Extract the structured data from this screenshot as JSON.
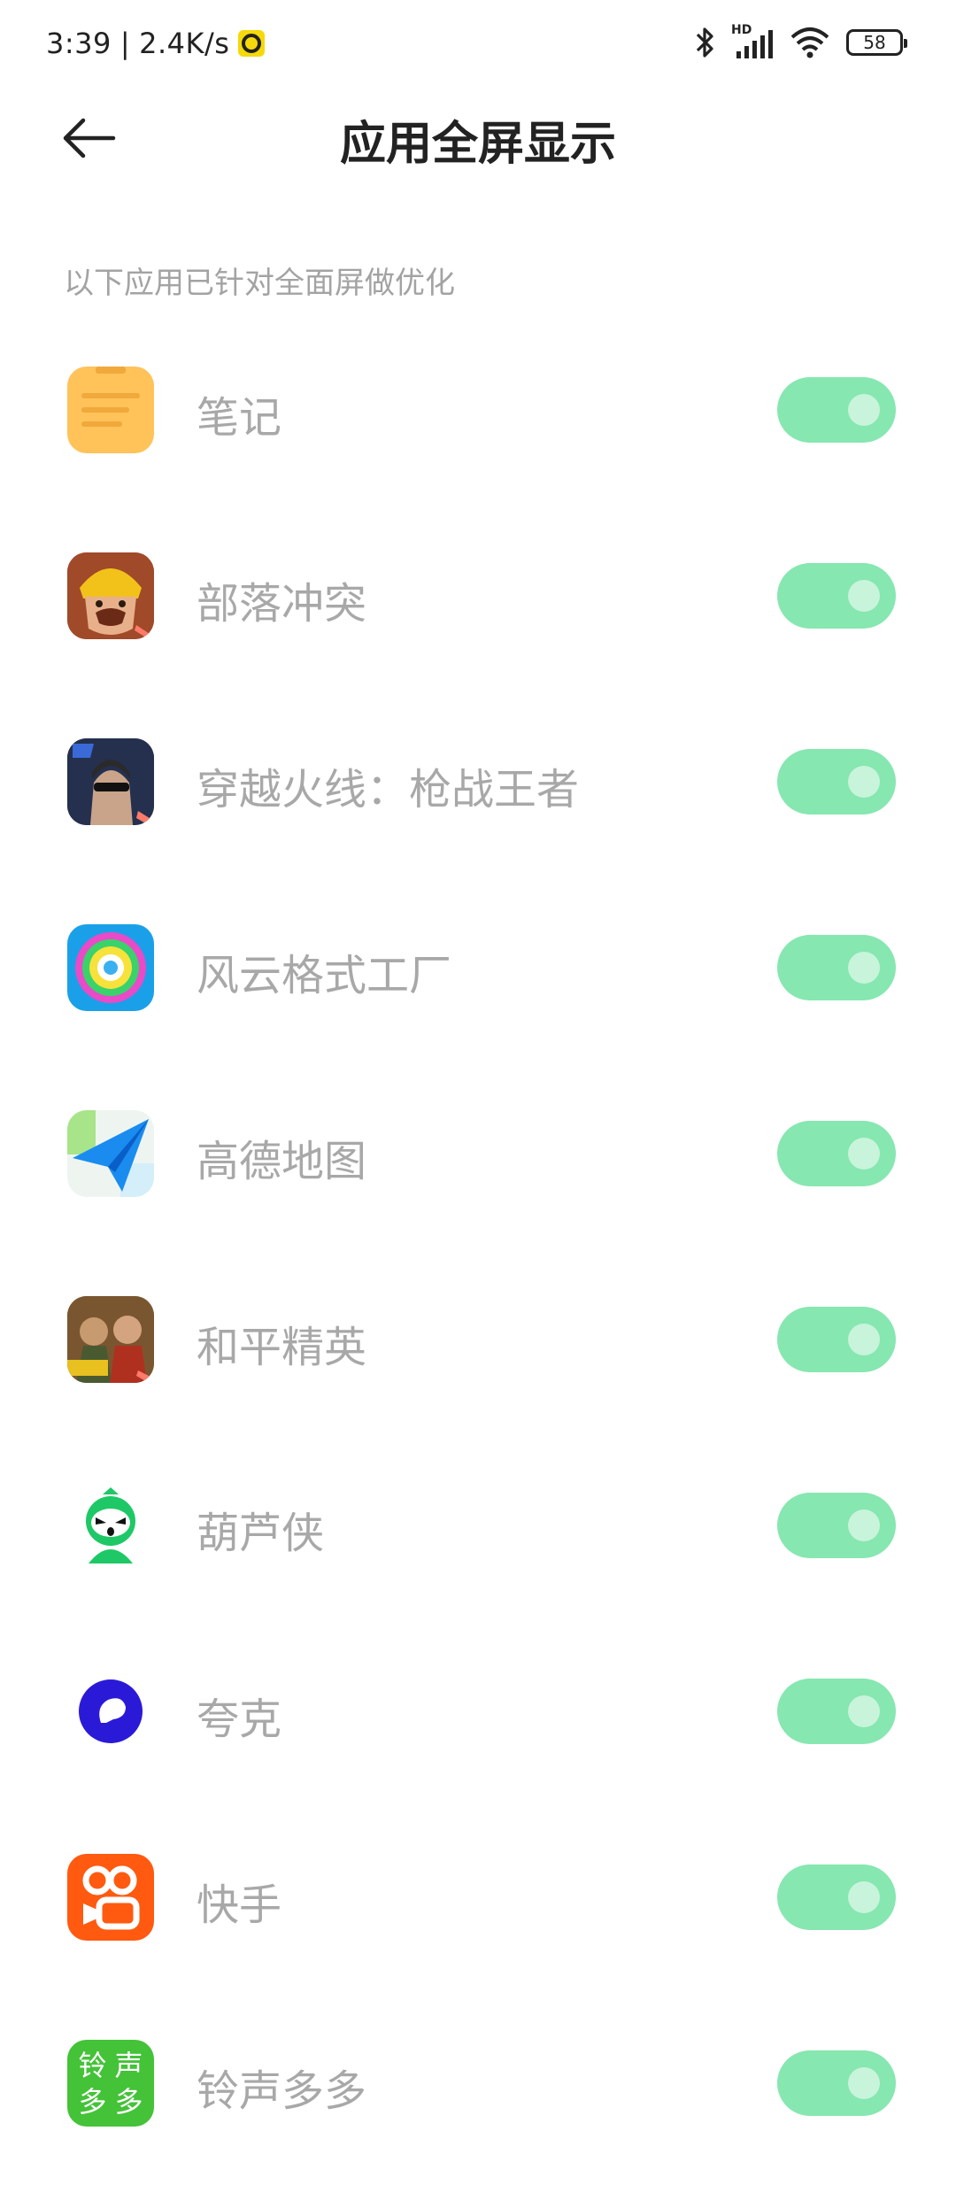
{
  "status_bar": {
    "time": "3:39",
    "separator": "|",
    "network_speed": "2.4K/s",
    "network_type": "HD",
    "battery": "58"
  },
  "header": {
    "back_icon": "arrow-left-icon",
    "title": "应用全屏显示"
  },
  "section_label": "以下应用已针对全面屏做优化",
  "colors": {
    "toggle_on": "#86e7b0",
    "text_secondary": "#a8a8a8",
    "title": "#222222"
  },
  "apps": [
    {
      "name": "笔记",
      "icon": "notes-app-icon",
      "enabled": true
    },
    {
      "name": "部落冲突",
      "icon": "clash-of-clans-icon",
      "enabled": true
    },
    {
      "name": "穿越火线：枪战王者",
      "icon": "crossfire-icon",
      "enabled": true
    },
    {
      "name": "风云格式工厂",
      "icon": "format-factory-icon",
      "enabled": true
    },
    {
      "name": "高德地图",
      "icon": "amap-icon",
      "enabled": true
    },
    {
      "name": "和平精英",
      "icon": "peacekeeper-elite-icon",
      "enabled": true
    },
    {
      "name": "葫芦侠",
      "icon": "huluxia-icon",
      "enabled": true
    },
    {
      "name": "夸克",
      "icon": "quark-icon",
      "enabled": true
    },
    {
      "name": "快手",
      "icon": "kuaishou-icon",
      "enabled": true
    },
    {
      "name": "铃声多多",
      "icon": "ringtone-app-icon",
      "enabled": true
    }
  ],
  "icon_text": {
    "ringtone": [
      "铃",
      "声",
      "多",
      "多"
    ]
  }
}
